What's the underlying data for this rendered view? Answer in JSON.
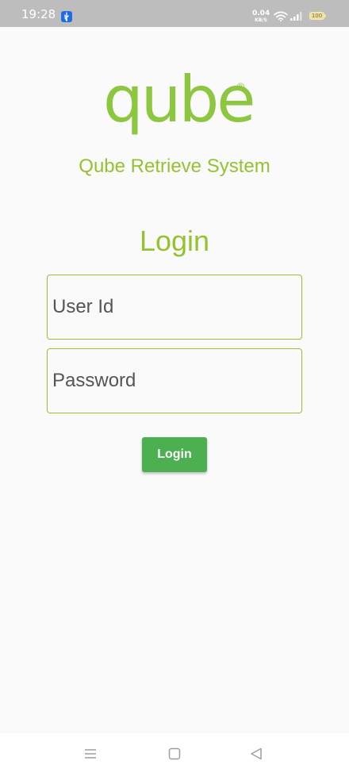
{
  "status_bar": {
    "time": "19:28",
    "net_speed_value": "0.04",
    "net_speed_unit": "KB/S",
    "battery": "100",
    "icons": [
      "usb-icon",
      "wifi-icon",
      "signal-icon",
      "battery-icon"
    ]
  },
  "logo": {
    "wordmark": "qube",
    "registered": "®",
    "color": "#8dc63f"
  },
  "app": {
    "subtitle": "Qube Retrieve System"
  },
  "login": {
    "title": "Login",
    "user_id_placeholder": "User Id",
    "user_id_value": "",
    "password_placeholder": "Password",
    "password_value": "",
    "button_label": "Login"
  },
  "colors": {
    "accent": "#95c22f",
    "button": "#4caf50",
    "background": "#fafafa",
    "status_bar": "#bdbdbd"
  },
  "nav_bar": {
    "icons": [
      "menu-icon",
      "home-icon",
      "back-icon"
    ]
  }
}
